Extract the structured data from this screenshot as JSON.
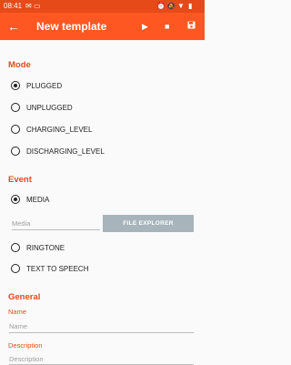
{
  "status": {
    "time": "08:41"
  },
  "appbar": {
    "title": "New template"
  },
  "mode": {
    "header": "Mode",
    "options": [
      "PLUGGED",
      "UNPLUGGED",
      "CHARGING_LEVEL",
      "DISCHARGING_LEVEL"
    ],
    "selected": "PLUGGED"
  },
  "event": {
    "header": "Event",
    "options": [
      "MEDIA",
      "RINGTONE",
      "TEXT TO SPEECH"
    ],
    "selected": "MEDIA",
    "media_placeholder": "Media",
    "file_explorer_label": "FILE EXPLORER"
  },
  "general": {
    "header": "General",
    "name_label": "Name",
    "name_placeholder": "Name",
    "description_label": "Description",
    "description_placeholder": "Description"
  },
  "colors": {
    "primary": "#ff5722",
    "primary_dark": "#e64a19",
    "button": "#a7b4bb"
  }
}
